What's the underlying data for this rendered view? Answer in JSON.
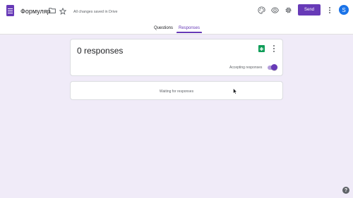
{
  "header": {
    "doc_title": "Формуляр",
    "saved_status": "All changes saved in Drive",
    "send_label": "Send",
    "avatar_initial": "S",
    "icons": [
      "folder-icon",
      "star-icon",
      "palette-icon",
      "preview-eye-icon",
      "settings-gear-icon",
      "more-vert-icon"
    ]
  },
  "tabs": [
    {
      "label": "Questions",
      "active": false
    },
    {
      "label": "Responses",
      "active": true
    }
  ],
  "summary": {
    "count_label": "0 responses",
    "accepting_label": "Accepting responses",
    "accepting_on": true
  },
  "waiting": {
    "text": "Waiting for responses"
  },
  "help": {
    "label": "?"
  },
  "colors": {
    "accent": "#673ab7",
    "background": "#f0ebf8",
    "sheets_green": "#0f9d58",
    "avatar_blue": "#1a73e8"
  }
}
